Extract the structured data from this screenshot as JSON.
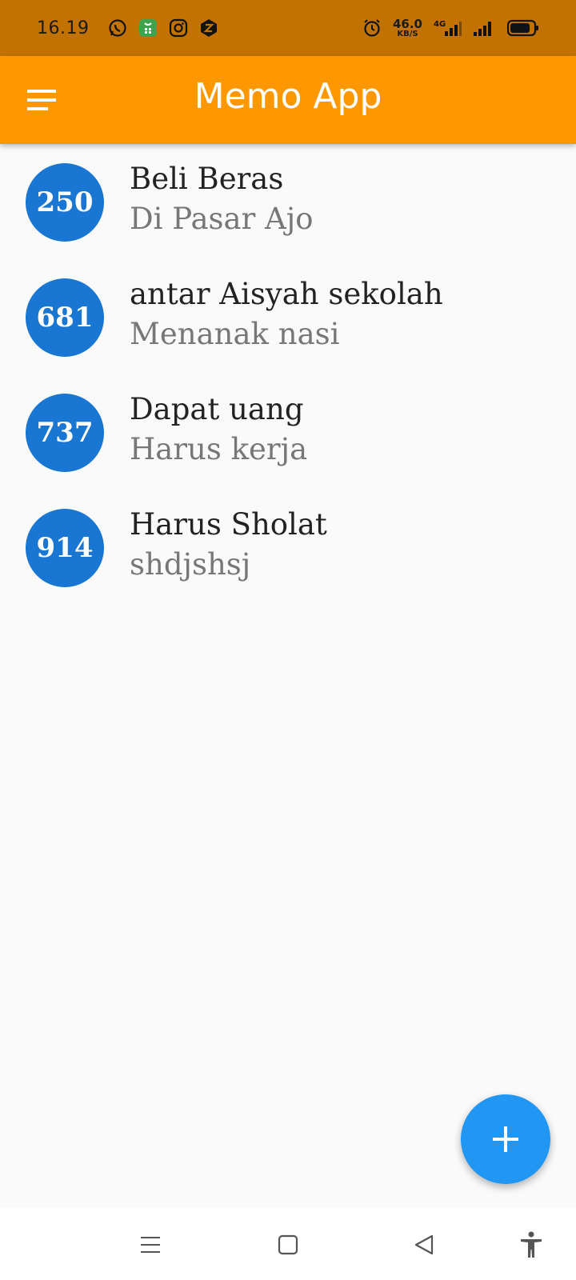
{
  "status_bar": {
    "time": "16.19",
    "icons": [
      "whatsapp-icon",
      "shop-icon",
      "instagram-icon",
      "z-app-icon"
    ],
    "net_speed_value": "46.0",
    "net_speed_unit": "KB/S",
    "network_label": "4G",
    "right_icons": [
      "alarm-icon",
      "signal-4g-icon",
      "signal-icon",
      "battery-icon"
    ]
  },
  "app_bar": {
    "title": "Memo App",
    "menu_icon": "menu-icon",
    "color": "#ff9800"
  },
  "memos": [
    {
      "id": "250",
      "title": "Beli Beras",
      "subtitle": "Di Pasar Ajo"
    },
    {
      "id": "681",
      "title": "antar Aisyah sekolah",
      "subtitle": "Menanak nasi"
    },
    {
      "id": "737",
      "title": "Dapat uang",
      "subtitle": "Harus kerja"
    },
    {
      "id": "914",
      "title": "Harus Sholat",
      "subtitle": "shdjshsj"
    }
  ],
  "fab": {
    "icon": "add-icon",
    "color": "#2196f3"
  },
  "nav_bar": {
    "buttons": [
      "recents-icon",
      "home-icon",
      "back-icon",
      "accessibility-icon"
    ]
  },
  "colors": {
    "status_bar": "#c17200",
    "avatar": "#1976d2",
    "background": "#fafafa"
  }
}
